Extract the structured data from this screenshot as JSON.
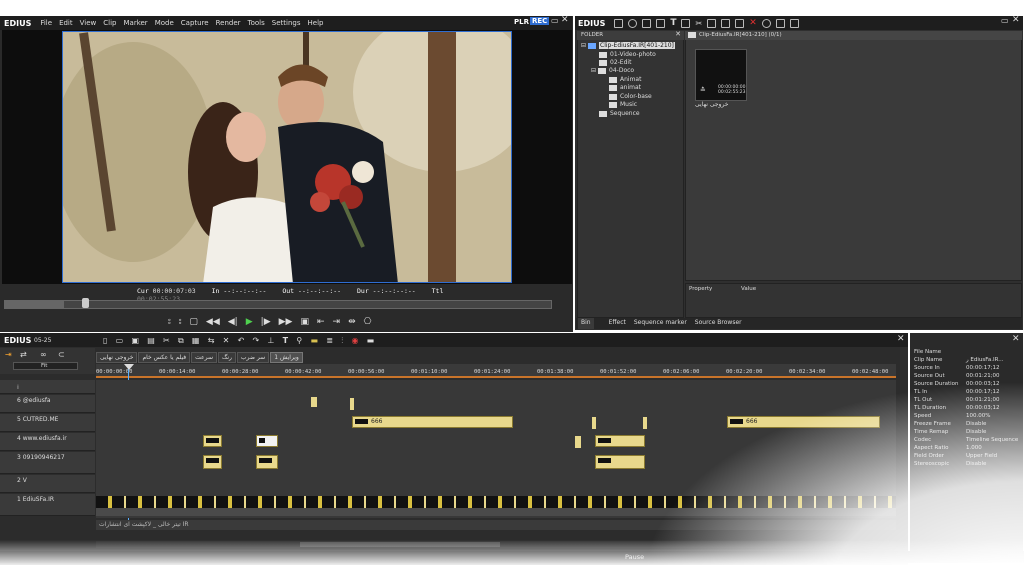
{
  "app": {
    "logo": "EDIUS",
    "menu": [
      "File",
      "Edit",
      "View",
      "Clip",
      "Marker",
      "Mode",
      "Capture",
      "Render",
      "Tools",
      "Settings",
      "Help"
    ],
    "plr": "PLR",
    "rec": "REC"
  },
  "preview": {
    "cur_label": "Cur",
    "cur": "00:00:07:03",
    "in_label": "In",
    "in": "--:--:--:--",
    "out_label": "Out",
    "out": "--:--:--:--",
    "dur_label": "Dur",
    "dur": "--:--:--:--",
    "ttl_label": "Ttl",
    "ttl": "00:02:55:23",
    "controls": [
      "⌐",
      "⌐",
      "▢",
      "◁◁",
      "◁|",
      "▷",
      "|▷",
      "▷▷",
      "▣",
      "[→",
      "→]",
      "→[",
      "⎔"
    ]
  },
  "bin": {
    "logo": "EDIUS",
    "folder_header": "FOLDER",
    "path_header": "Clip-EdiusFa.IR[401-210] (0/1)",
    "tree": [
      {
        "label": "Clip-EdiusFa.IR[401-210]",
        "level": 0
      },
      {
        "label": "01-Video-photo",
        "level": 1
      },
      {
        "label": "02-Edit",
        "level": 1
      },
      {
        "label": "04-Doco",
        "level": 1
      },
      {
        "label": "Animat",
        "level": 2
      },
      {
        "label": "animat",
        "level": 2
      },
      {
        "label": "Color-base",
        "level": 2
      },
      {
        "label": "Music",
        "level": 2
      },
      {
        "label": "Sequence",
        "level": 1
      }
    ],
    "clip_thumb_tc": "00:00:00:00\n00:02:55:23",
    "clip_name": "خروجی نهایی",
    "property_header": "Property",
    "value_header": "Value",
    "tabs": [
      "Bin",
      "Effect",
      "Sequence marker",
      "Source Browser"
    ]
  },
  "timeline": {
    "logo": "EDIUS",
    "version": "05-25",
    "seq_tabs": [
      "خروجی نهایی",
      "فیلم یا عکس خام",
      "سرعت",
      "رنگ",
      "سر ضرب",
      "ویرایش 1"
    ],
    "fit_label": "Fit",
    "ruler": [
      "00:00:00:00",
      "00:00:14:00",
      "00:00:28:00",
      "00:00:42:00",
      "00:00:56:00",
      "00:01:10:00",
      "00:01:24:00",
      "00:01:38:00",
      "00:01:52:00",
      "00:02:06:00",
      "00:02:20:00",
      "00:02:34:00",
      "00:02:48:00"
    ],
    "tracks": [
      "6 @ediusfa",
      "5 CUTRED.ME",
      "4 www.ediusfa.ir",
      "3 09190946217",
      "2 V",
      "1 EdiuSFa.IR"
    ],
    "clip_666": "666",
    "text_track": "تیتر خالی _ لاکپشت ای انتشارات IR",
    "status": "Pause"
  },
  "properties": [
    [
      "File Name",
      ""
    ],
    [
      "Clip Name",
      "ر EdiusFa.IR..."
    ],
    [
      "Source In",
      "00:00:17;12"
    ],
    [
      "Source Out",
      "00:01:21;00"
    ],
    [
      "Source Duration",
      "00:00:03;12"
    ],
    [
      "TL In",
      "00:00:17;12"
    ],
    [
      "TL Out",
      "00:01:21;00"
    ],
    [
      "TL Duration",
      "00:00:03;12"
    ],
    [
      "Speed",
      "100.00%"
    ],
    [
      "Freeze Frame",
      "Disable"
    ],
    [
      "Time Remap",
      "Disable"
    ],
    [
      "Codec",
      "Timeline Sequence"
    ],
    [
      "Aspect Ratio",
      "1.000"
    ],
    [
      "Field Order",
      "Upper Field"
    ],
    [
      "Stereoscopic",
      "Disable"
    ]
  ],
  "colors": {
    "accent": "#2f6dd1",
    "clip_yellow": "#e8d88c",
    "panel": "#2b2b2b"
  }
}
